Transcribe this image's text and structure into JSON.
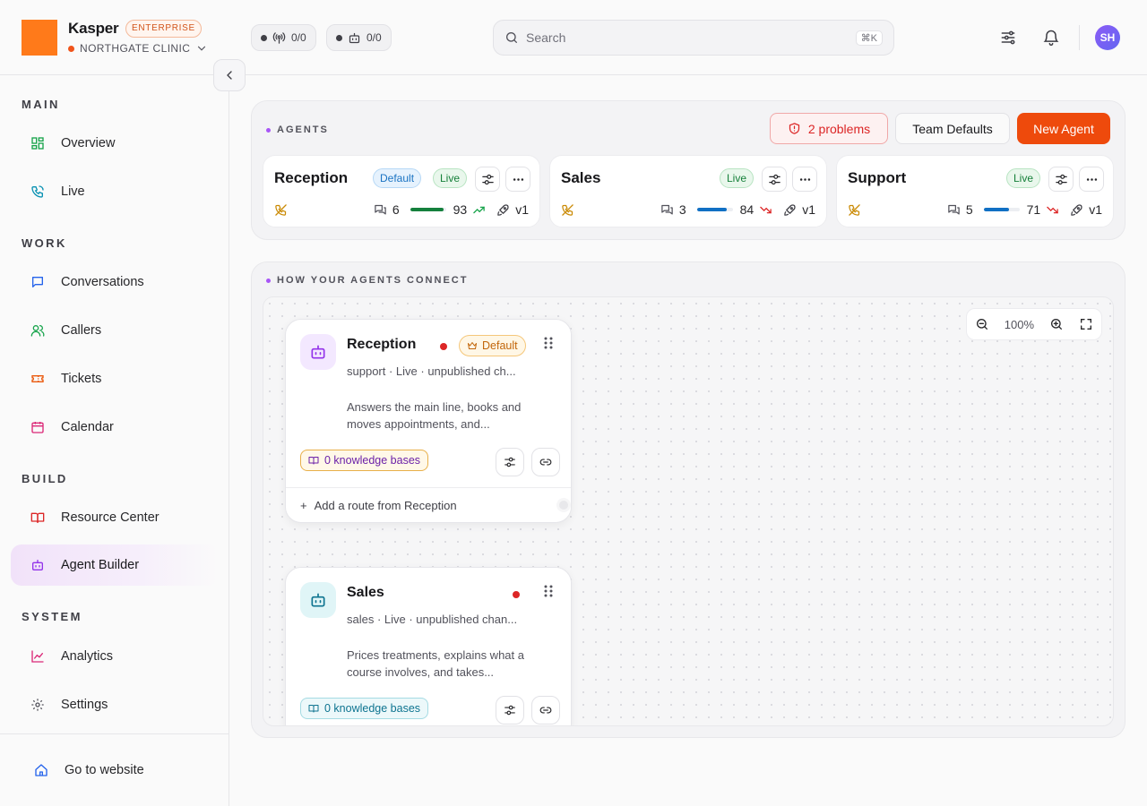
{
  "header": {
    "brand": "Kasper",
    "plan_badge": "ENTERPRISE",
    "org": "NORTHGATE CLINIC",
    "pill_calls": "0/0",
    "pill_agents": "0/0",
    "search_placeholder": "Search",
    "search_shortcut": "⌘K",
    "avatar_initials": "SH"
  },
  "sidebar": {
    "sections": {
      "main": "MAIN",
      "work": "WORK",
      "build": "BUILD",
      "system": "SYSTEM"
    },
    "items": {
      "overview": "Overview",
      "live": "Live",
      "conversations": "Conversations",
      "callers": "Callers",
      "tickets": "Tickets",
      "calendar": "Calendar",
      "resource_center": "Resource Center",
      "agent_builder": "Agent Builder",
      "analytics": "Analytics",
      "settings": "Settings"
    },
    "footer_link": "Go to website",
    "active": "agent_builder"
  },
  "agents_panel": {
    "title": "AGENTS",
    "problems_button": "2 problems",
    "team_defaults_button": "Team Defaults",
    "new_agent_button": "New Agent",
    "cards": [
      {
        "name": "Reception",
        "default_badge": "Default",
        "live_badge": "Live",
        "conversations": "6",
        "score": "93",
        "score_pct": 93,
        "trend": "up",
        "bar_color": "#15803d",
        "version": "v1"
      },
      {
        "name": "Sales",
        "live_badge": "Live",
        "conversations": "3",
        "score": "84",
        "score_pct": 84,
        "trend": "down",
        "bar_color": "#1170c4",
        "version": "v1"
      },
      {
        "name": "Support",
        "live_badge": "Live",
        "conversations": "5",
        "score": "71",
        "score_pct": 71,
        "trend": "down",
        "bar_color": "#1170c4",
        "version": "v1"
      }
    ]
  },
  "connect_panel": {
    "title": "HOW YOUR AGENTS CONNECT",
    "zoom": "100%",
    "nodes": [
      {
        "name": "Reception",
        "default_badge": "Default",
        "subtitle": "support · Live · unpublished ch...",
        "description": "Answers the main line, books and moves appointments, and...",
        "knowledge": "0 knowledge bases",
        "add_route": "Add a route from Reception"
      },
      {
        "name": "Sales",
        "subtitle": "sales · Live · unpublished chan...",
        "description": "Prices treatments, explains what a course involves, and takes...",
        "knowledge": "0 knowledge bases"
      }
    ]
  },
  "colors": {
    "brand_orange": "#ff7a1a",
    "accent": "#ee4a0c",
    "danger": "#dc2626",
    "active_nav": "#f1e2f9"
  }
}
